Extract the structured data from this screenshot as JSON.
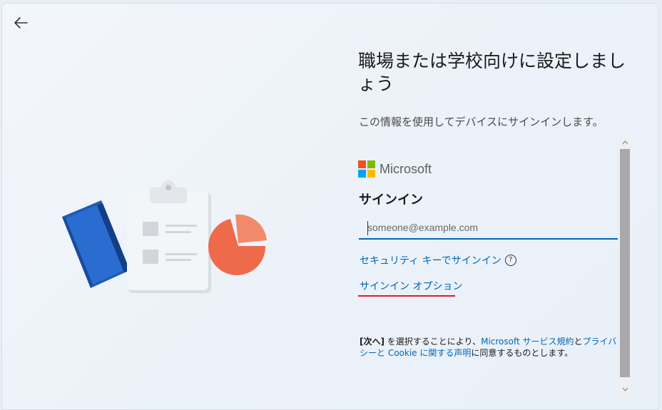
{
  "page": {
    "title": "職場または学校向けに設定しましょう",
    "subtitle": "この情報を使用してデバイスにサインインします。"
  },
  "microsoft": {
    "logo_text": "Microsoft",
    "colors": [
      "#f25022",
      "#7fba00",
      "#00a4ef",
      "#ffb900"
    ]
  },
  "signin": {
    "heading": "サインイン",
    "email_placeholder": "someone@example.com",
    "security_key_link": "セキュリティ キーでサインイン",
    "help_icon": "?",
    "options_link": "サインイン オプション"
  },
  "terms": {
    "part1": "[次へ]",
    "part2": " を選択することにより、",
    "link1": "Microsoft サービス規約",
    "part3": "と",
    "link2": "プライバシーと Cookie に関する声明",
    "part4": "に同意するものとします。"
  },
  "icons": {
    "back": "back-arrow-icon",
    "scroll_up": "chevron-up-icon",
    "scroll_down": "chevron-down-icon"
  },
  "colors": {
    "accent": "#0067b8",
    "annotation_red": "#e8192c"
  }
}
